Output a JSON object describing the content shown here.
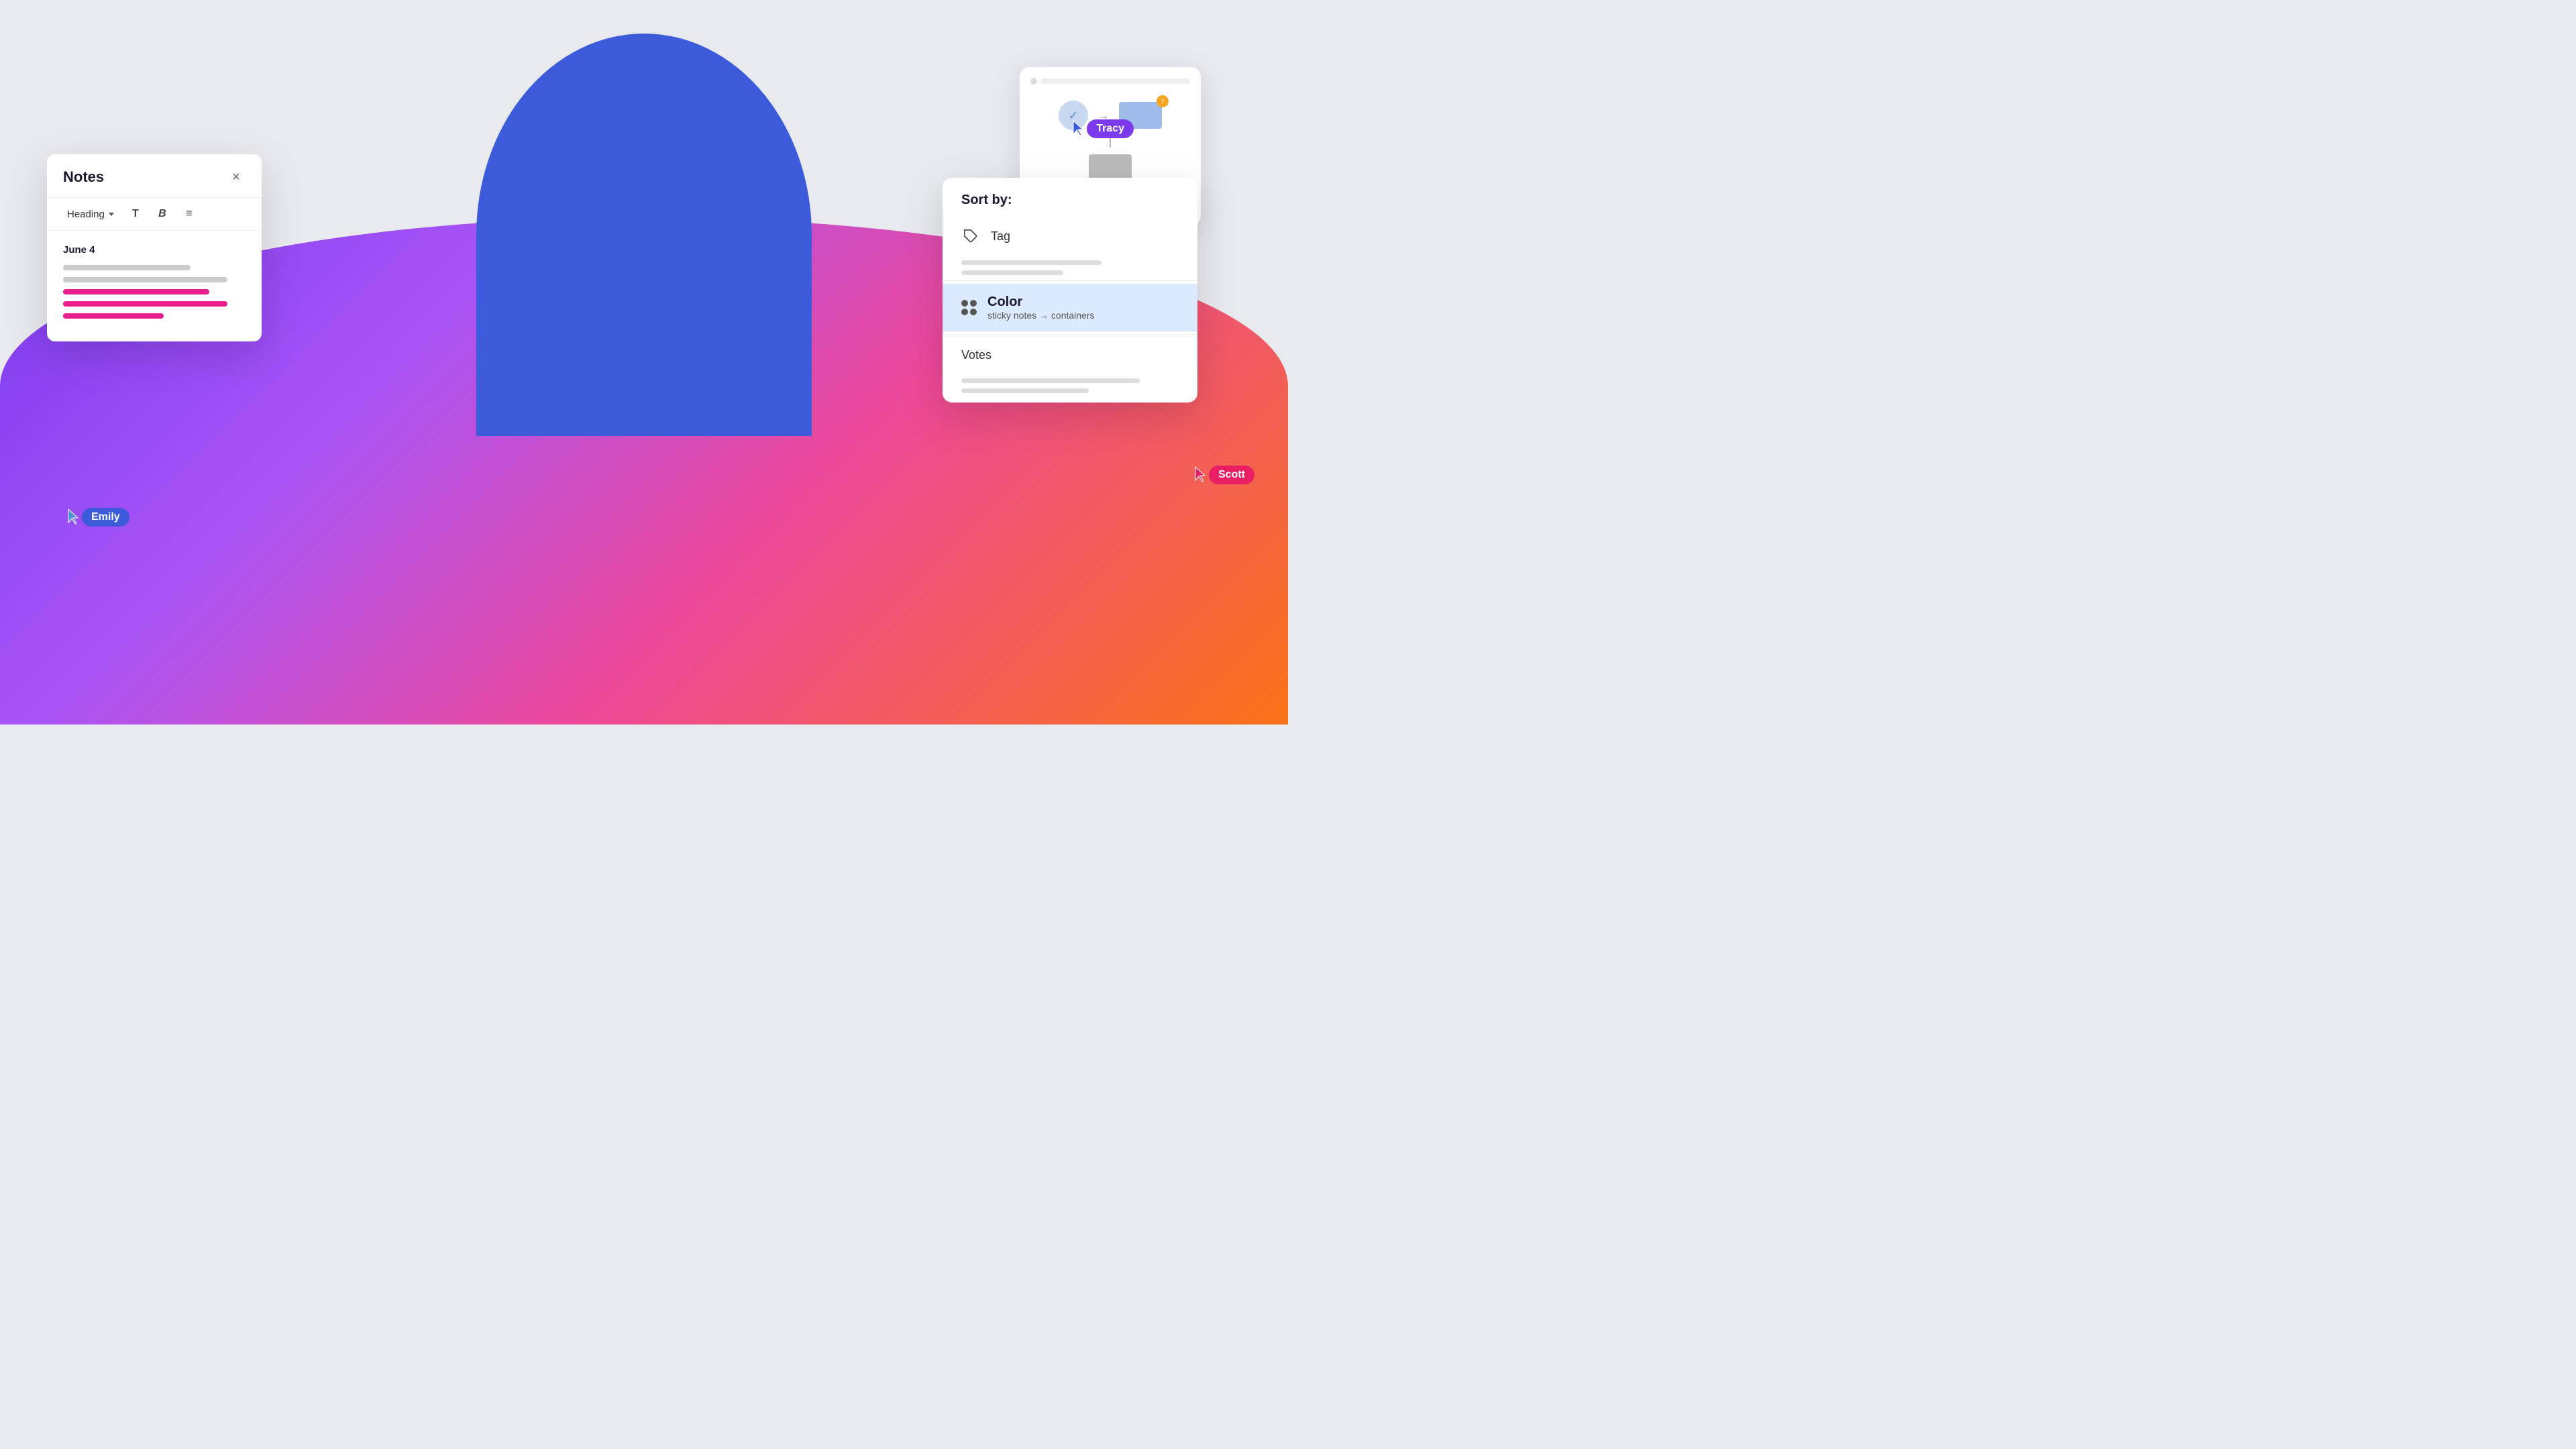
{
  "background": {
    "blob_color": "linear-gradient(135deg, #7c3aed 0%, #a855f7 30%, #ec4899 60%, #f97316 100%)",
    "circle_color": "#3b5bdb"
  },
  "notes_panel": {
    "title": "Notes",
    "close_label": "×",
    "toolbar": {
      "heading_label": "Heading",
      "chevron": "▾",
      "text_icon": "T",
      "bold_icon": "B",
      "list_icon": "≡"
    },
    "date_label": "June 4",
    "drag_handle_label": "⠿"
  },
  "sort_panel": {
    "header": "Sort by:",
    "items": [
      {
        "id": "tag",
        "label": "Tag",
        "icon": "tag"
      },
      {
        "id": "color",
        "label": "Color",
        "sub_label": "sticky notes → containers",
        "icon": "color",
        "highlighted": true
      },
      {
        "id": "votes",
        "label": "Votes",
        "icon": "votes"
      }
    ]
  },
  "diagram_panel": {
    "visible": true
  },
  "cursors": {
    "emily": {
      "label": "Emily",
      "color": "#3b5bdb"
    },
    "tracy": {
      "label": "Tracy",
      "color": "#7c3aed"
    },
    "scott": {
      "label": "Scott",
      "color": "#e91e63"
    }
  }
}
